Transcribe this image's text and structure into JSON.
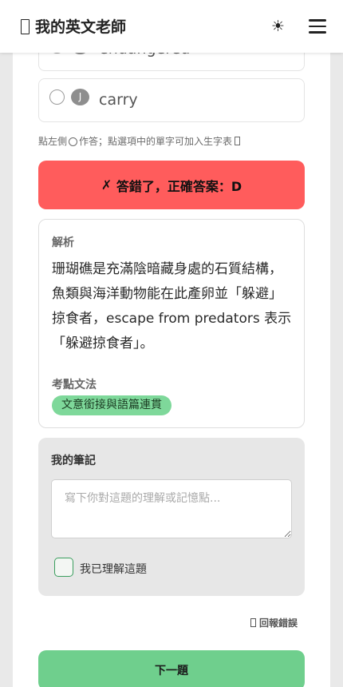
{
  "header": {
    "title": "我的英文老師",
    "theme_icon": "☀",
    "menu_icon": "hamburger-menu-icon"
  },
  "options": [
    {
      "letter": "",
      "word": "endangered"
    },
    {
      "letter": "J",
      "word": "carry"
    }
  ],
  "hint": {
    "before": "點左側",
    "after": "作答；點選項中的單字可加入生字表"
  },
  "result": {
    "icon": "✗",
    "text": "答錯了，正確答案：D",
    "color": "#ff5c5c"
  },
  "analysis": {
    "label": "解析",
    "text": "珊瑚礁是充滿陰暗藏身處的石質結構，魚類與海洋動物能在此產卵並「躲避」掠食者，escape from predators 表示「躲避掠食者」。",
    "grammar_label": "考點文法",
    "grammar_tag": "文意銜接與語篇連貫"
  },
  "notes": {
    "title": "我的筆記",
    "placeholder": "寫下你對這題的理解或記憶點...",
    "value": "",
    "understood_label": "我已理解這題",
    "understood_checked": false
  },
  "report_label": "回報錯誤",
  "next_label": "下一題",
  "colors": {
    "accent_green": "#6fcf8d",
    "tag_green": "#7ed89a",
    "error_red": "#ff5c5c"
  }
}
